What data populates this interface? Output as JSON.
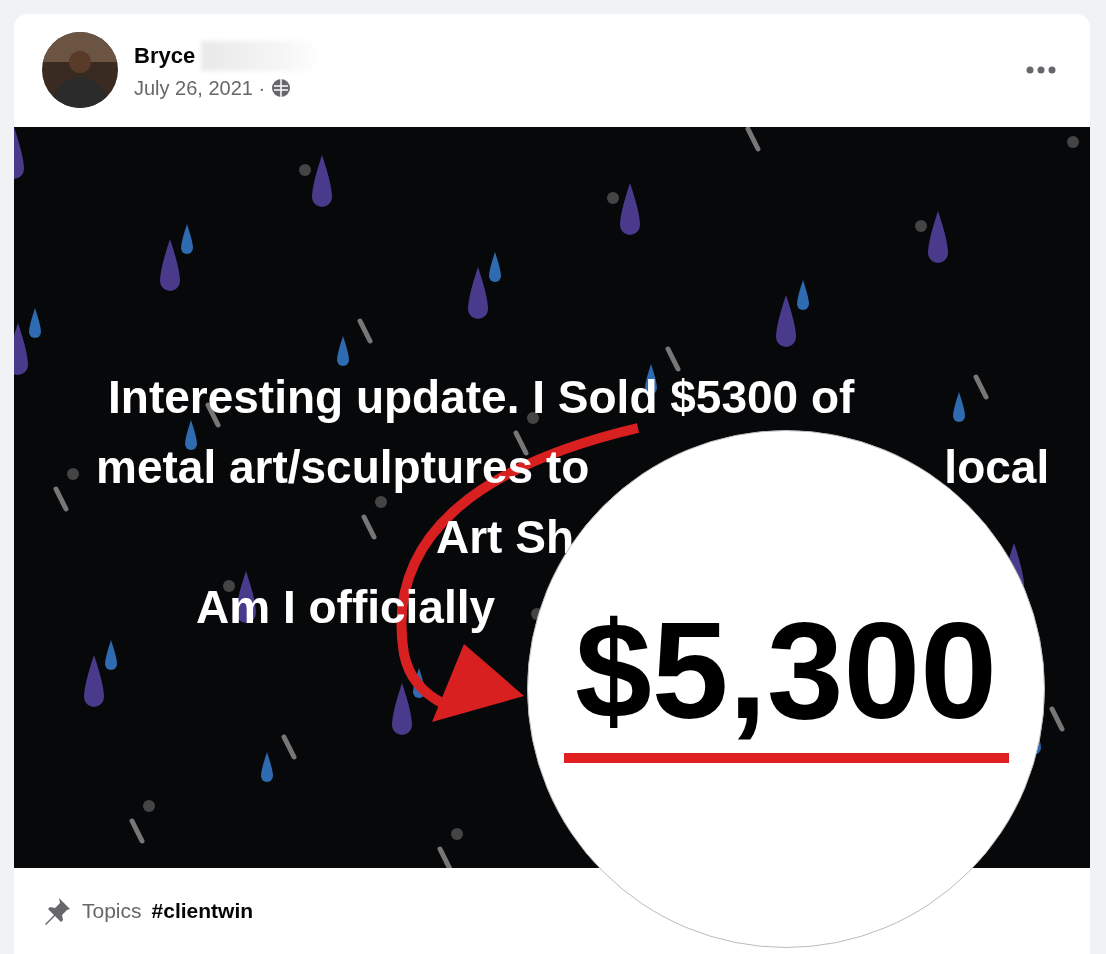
{
  "post": {
    "author": "Bryce",
    "date": "July 26, 2021 ·",
    "image_lines": [
      [
        "Interesting update. I Sold $5300 of"
      ],
      [
        "metal art/sculptures to",
        "local"
      ],
      [
        "Art Sh"
      ],
      [
        "Am I officially"
      ]
    ],
    "topics_label": "Topics",
    "topic": "#clientwin"
  },
  "callout": {
    "amount": "$5,300"
  }
}
